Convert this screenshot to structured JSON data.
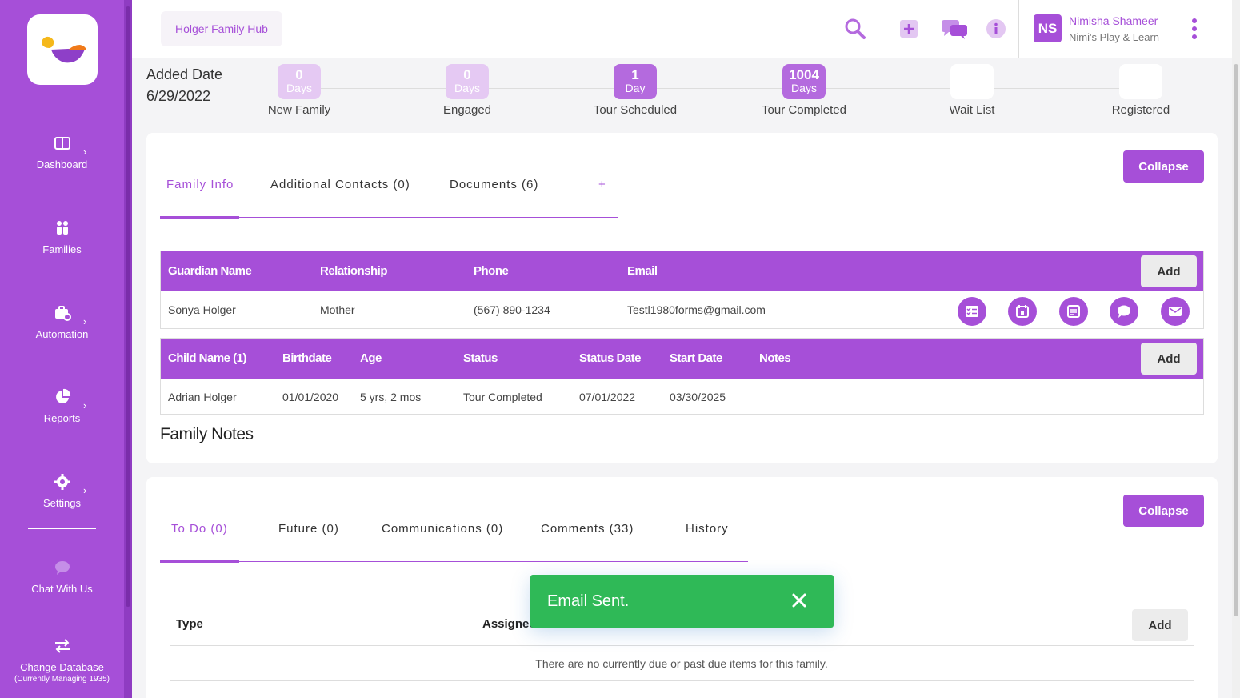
{
  "app": {
    "hub_title": "Holger Family Hub"
  },
  "user": {
    "initials": "NS",
    "name": "Nimisha Shameer",
    "org": "Nimi's Play & Learn"
  },
  "sidebar": {
    "items": [
      {
        "label": "Dashboard",
        "icon": "dashboard-icon"
      },
      {
        "label": "Families",
        "icon": "families-icon"
      },
      {
        "label": "Automation",
        "icon": "automation-icon"
      },
      {
        "label": "Reports",
        "icon": "pie-chart-icon"
      },
      {
        "label": "Settings",
        "icon": "gear-icon"
      },
      {
        "label": "Chat With Us",
        "icon": "chat-icon"
      },
      {
        "label": "Change Database",
        "icon": "swap-icon"
      }
    ],
    "db_note": "(Currently Managing 1935)"
  },
  "family": {
    "added_label": "Added Date",
    "added_date": "6/29/2022",
    "stages": [
      {
        "num": "0",
        "unit": "Days",
        "name": "New Family"
      },
      {
        "num": "0",
        "unit": "Days",
        "name": "Engaged"
      },
      {
        "num": "1",
        "unit": "Day",
        "name": "Tour Scheduled"
      },
      {
        "num": "1004",
        "unit": "Days",
        "name": "Tour Completed"
      },
      {
        "num": "",
        "unit": "",
        "name": "Wait List"
      },
      {
        "num": "",
        "unit": "",
        "name": "Registered"
      }
    ]
  },
  "info_card": {
    "collapse_label": "Collapse",
    "tabs": [
      "Family Info",
      "Additional Contacts (0)",
      "Documents (6)",
      "+"
    ],
    "guardians": {
      "headers": [
        "Guardian Name",
        "Relationship",
        "Phone",
        "Email"
      ],
      "add_label": "Add",
      "rows": [
        {
          "name": "Sonya Holger",
          "relationship": "Mother",
          "phone": "(567) 890-1234",
          "email": "Testl1980forms@gmail.com"
        }
      ]
    },
    "children": {
      "headers": [
        "Child Name (1)",
        "Birthdate",
        "Age",
        "Status",
        "Status Date",
        "Start Date",
        "Notes"
      ],
      "add_label": "Add",
      "rows": [
        {
          "name": "Adrian Holger",
          "birthdate": "01/01/2020",
          "age": "5 yrs, 2 mos",
          "status": "Tour Completed",
          "status_date": "07/01/2022",
          "start_date": "03/30/2025",
          "notes": ""
        }
      ]
    },
    "notes_title": "Family Notes"
  },
  "tasks_card": {
    "collapse_label": "Collapse",
    "tabs": [
      "To Do (0)",
      "Future (0)",
      "Communications (0)",
      "Comments (33)",
      "History"
    ],
    "headers": [
      "Type",
      "Assignee"
    ],
    "add_label": "Add",
    "empty_text": "There are no currently due or past due items for this family."
  },
  "toast": {
    "message": "Email Sent."
  },
  "colors": {
    "primary": "#a64fd8",
    "success": "#2fb957",
    "stage_light": "#e5c9f3",
    "stage_strong": "#b46ade"
  }
}
